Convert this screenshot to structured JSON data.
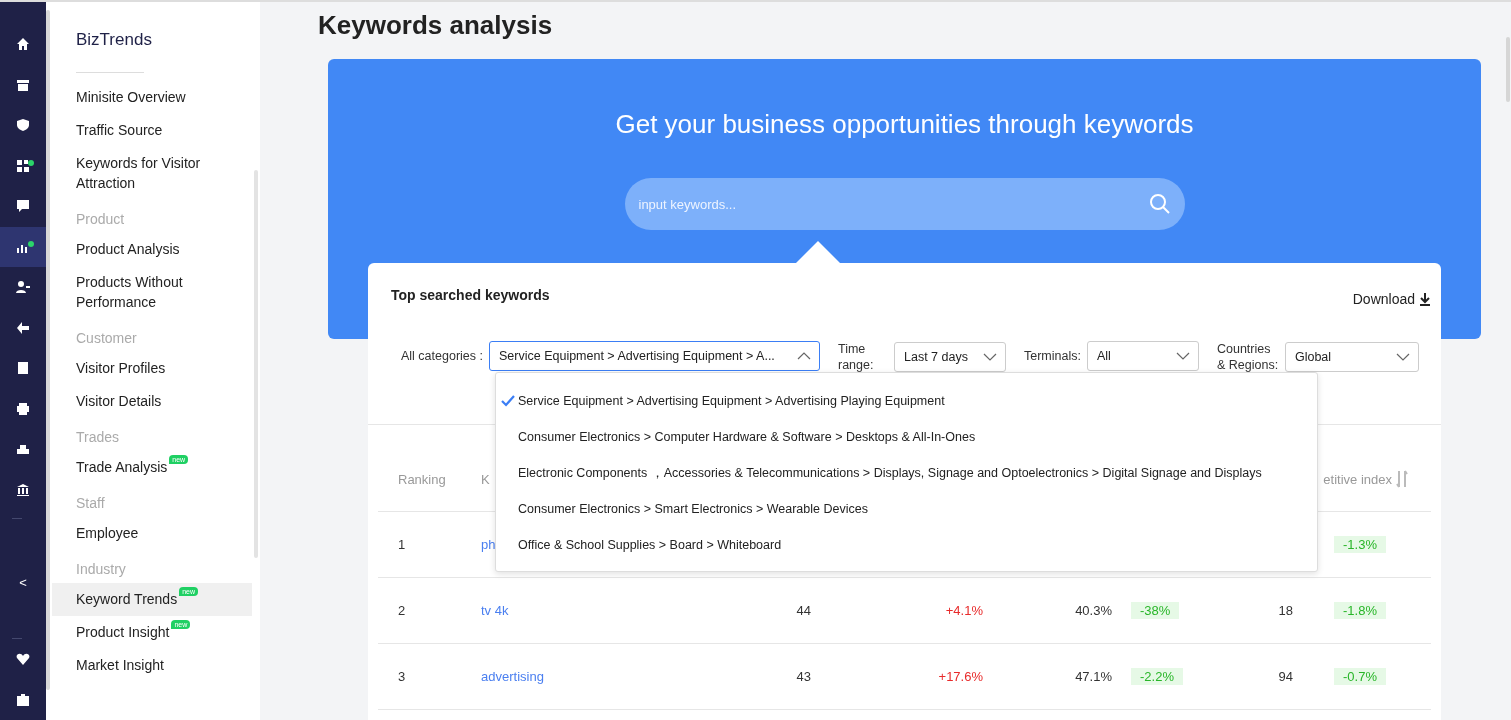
{
  "nav_rail": {
    "icons": [
      {
        "selected": false,
        "dot": false
      },
      {
        "selected": false,
        "dot": false
      },
      {
        "selected": false,
        "dot": false
      },
      {
        "selected": false,
        "dot": true
      },
      {
        "selected": false,
        "dot": false
      },
      {
        "selected": true,
        "dot": true
      },
      {
        "selected": false,
        "dot": false
      },
      {
        "selected": false,
        "dot": false
      },
      {
        "selected": false,
        "dot": false
      },
      {
        "selected": false,
        "dot": false
      },
      {
        "selected": false,
        "dot": false
      },
      {
        "selected": false,
        "dot": false
      }
    ],
    "collapse": "<"
  },
  "sidebar": {
    "title": "BizTrends",
    "sections": [
      {
        "items": [
          {
            "label": "Minisite Overview",
            "selected": false
          },
          {
            "label": "Traffic Source",
            "selected": false
          },
          {
            "label": "Keywords for Visitor Attraction",
            "selected": false
          }
        ]
      },
      {
        "heading": "Product",
        "items": [
          {
            "label": "Product Analysis",
            "selected": false
          },
          {
            "label": "Products Without Performance",
            "selected": false
          }
        ]
      },
      {
        "heading": "Customer",
        "items": [
          {
            "label": "Visitor Profiles",
            "selected": false
          },
          {
            "label": "Visitor Details",
            "selected": false
          }
        ]
      },
      {
        "heading": "Trades",
        "items": [
          {
            "label": "Trade Analysis",
            "selected": false,
            "badge": "new"
          }
        ]
      },
      {
        "heading": "Staff",
        "items": [
          {
            "label": "Employee",
            "selected": false
          }
        ]
      },
      {
        "heading": "Industry",
        "items": [
          {
            "label": "Keyword Trends",
            "selected": true,
            "badge": "new"
          },
          {
            "label": "Product Insight",
            "selected": false,
            "badge": "new"
          },
          {
            "label": "Market Insight",
            "selected": false
          }
        ]
      }
    ]
  },
  "page_title": "Keywords analysis",
  "banner": {
    "headline": "Get your business opportunities through keywords",
    "search": {
      "placeholder": "input keywords..."
    }
  },
  "card": {
    "title": "Top searched keywords",
    "download": "Download",
    "filters": [
      {
        "label": "All categories :",
        "value": "Service Equipment > Advertising Equipment > A...",
        "expanded": true
      },
      {
        "label": "Time range:",
        "value": "Last 7 days",
        "expanded": false
      },
      {
        "label": "Terminals:",
        "value": "All",
        "expanded": false
      },
      {
        "label": "Countries & Regions:",
        "value": "Global",
        "expanded": false
      }
    ],
    "category_menu": [
      {
        "label": "Service Equipment > Advertising Equipment > Advertising Playing Equipment",
        "selected": true
      },
      {
        "label": "Consumer Electronics > Computer Hardware & Software > Desktops & All-In-Ones",
        "selected": false
      },
      {
        "label": "Electronic Components ，Accessories & Telecommunications > Displays, Signage and Optoelectronics > Digital Signage and Displays",
        "selected": false
      },
      {
        "label": "Consumer Electronics > Smart Electronics > Wearable Devices",
        "selected": false
      },
      {
        "label": "Office & School Supplies > Board > Whiteboard",
        "selected": false
      }
    ],
    "table": {
      "header": {
        "column_1": "Ranking",
        "column_2": "K",
        "column_8": "etitive index"
      },
      "rows": [
        {
          "column_1": "1",
          "column_2": "ph",
          "column_8": "-1.3%"
        },
        {
          "column_1": "2",
          "column_2": "tv 4k",
          "column_3": "44",
          "column_4": "+4.1%",
          "column_5": "40.3%",
          "column_6": "-38%",
          "column_7": "18",
          "column_8": "-1.8%"
        },
        {
          "column_1": "3",
          "column_2": "advertising",
          "column_3": "43",
          "column_4": "+17.6%",
          "column_5": "47.1%",
          "column_6": "-2.2%",
          "column_7": "94",
          "column_8": "-0.7%"
        }
      ]
    }
  }
}
